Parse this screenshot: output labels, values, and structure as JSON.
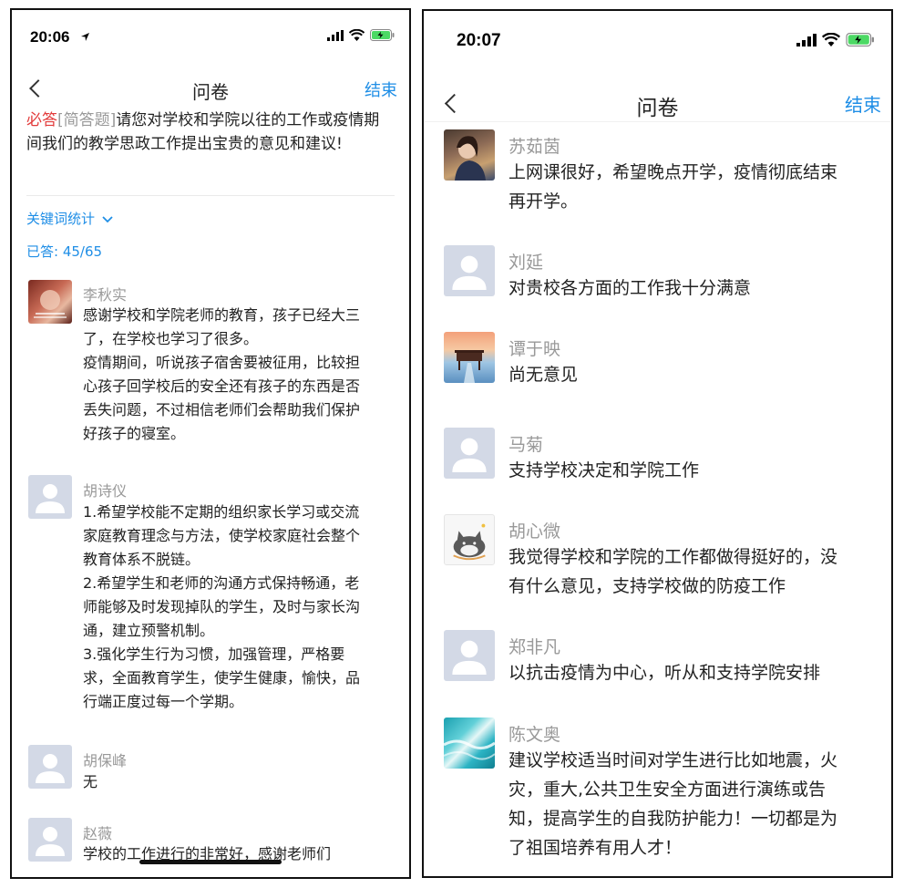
{
  "left": {
    "status": {
      "time": "20:06"
    },
    "nav": {
      "title": "问卷",
      "end": "结束"
    },
    "question": {
      "required": "必答",
      "type": "[简答题]",
      "text": "请您对学校和学院以往的工作或疫情期间我们的教学思政工作提出宝贵的意见和建议!"
    },
    "keyword_stats": "关键词统计",
    "answered": "已答: 45/65",
    "answers": [
      {
        "name": "李秋实",
        "text": "感谢学校和学院老师的教育，孩子已经大三\n了，在学校也学习了很多。\n疫情期间，听说孩子宿舍要被征用，比较担\n心孩子回学校后的安全还有孩子的东西是否\n丢失问题，不过相信老师们会帮助我们保护\n好孩子的寝室。"
      },
      {
        "name": "胡诗仪",
        "text": "1.希望学校能不定期的组织家长学习或交流\n家庭教育理念与方法，使学校家庭社会整个\n教育体系不脱链。\n2.希望学生和老师的沟通方式保持畅通，老\n师能够及时发现掉队的学生，及时与家长沟\n通，建立预警机制。\n3.强化学生行为习惯，加强管理，严格要\n求，全面教育学生，使学生健康，愉快，品\n行端正度过每一个学期。"
      },
      {
        "name": "胡保峰",
        "text": "无"
      },
      {
        "name": "赵薇",
        "text": "学校的工作进行的非常好，感谢老师们"
      }
    ]
  },
  "right": {
    "status": {
      "time": "20:07"
    },
    "nav": {
      "title": "问卷",
      "end": "结束"
    },
    "answers": [
      {
        "name": "苏茹茵",
        "text": "上网课很好，希望晚点开学，疫情彻底结束\n再开学。"
      },
      {
        "name": "刘延",
        "text": "对贵校各方面的工作我十分满意"
      },
      {
        "name": "谭于映",
        "text": "尚无意见"
      },
      {
        "name": "马菊",
        "text": "支持学校决定和学院工作"
      },
      {
        "name": "胡心微",
        "text": "我觉得学校和学院的工作都做得挺好的，没\n有什么意见，支持学校做的防疫工作"
      },
      {
        "name": "郑非凡",
        "text": "以抗击疫情为中心，听从和支持学院安排"
      },
      {
        "name": "陈文奥",
        "text": "建议学校适当时间对学生进行比如地震，火\n灾，重大,公共卫生安全方面进行演练或告\n知，提高学生的自我防护能力！一切都是为\n了祖国培养有用人才！"
      }
    ]
  },
  "colors": {
    "accent": "#1f8ee6",
    "required": "#e23b3b",
    "muted": "#999999",
    "avatar_default": "#d3d9e6",
    "battery": "#4cd964"
  },
  "icons": [
    "location-arrow-icon",
    "signal-icon",
    "wifi-icon",
    "battery-icon",
    "back-chevron-icon",
    "chevron-down-icon",
    "default-avatar-icon"
  ]
}
